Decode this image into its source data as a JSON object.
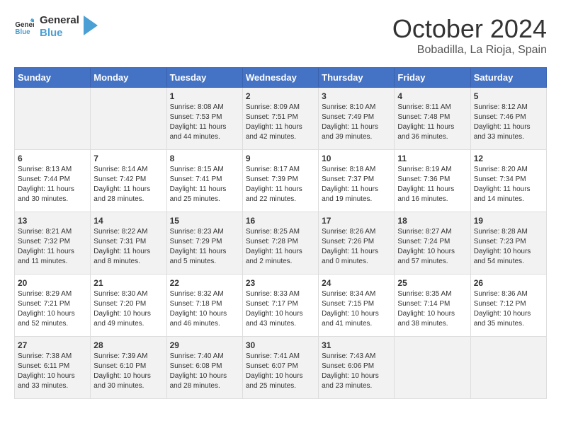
{
  "logo": {
    "line1": "General",
    "line2": "Blue"
  },
  "title": "October 2024",
  "subtitle": "Bobadilla, La Rioja, Spain",
  "days_of_week": [
    "Sunday",
    "Monday",
    "Tuesday",
    "Wednesday",
    "Thursday",
    "Friday",
    "Saturday"
  ],
  "weeks": [
    [
      {
        "day": "",
        "text": ""
      },
      {
        "day": "",
        "text": ""
      },
      {
        "day": "1",
        "text": "Sunrise: 8:08 AM\nSunset: 7:53 PM\nDaylight: 11 hours and 44 minutes."
      },
      {
        "day": "2",
        "text": "Sunrise: 8:09 AM\nSunset: 7:51 PM\nDaylight: 11 hours and 42 minutes."
      },
      {
        "day": "3",
        "text": "Sunrise: 8:10 AM\nSunset: 7:49 PM\nDaylight: 11 hours and 39 minutes."
      },
      {
        "day": "4",
        "text": "Sunrise: 8:11 AM\nSunset: 7:48 PM\nDaylight: 11 hours and 36 minutes."
      },
      {
        "day": "5",
        "text": "Sunrise: 8:12 AM\nSunset: 7:46 PM\nDaylight: 11 hours and 33 minutes."
      }
    ],
    [
      {
        "day": "6",
        "text": "Sunrise: 8:13 AM\nSunset: 7:44 PM\nDaylight: 11 hours and 30 minutes."
      },
      {
        "day": "7",
        "text": "Sunrise: 8:14 AM\nSunset: 7:42 PM\nDaylight: 11 hours and 28 minutes."
      },
      {
        "day": "8",
        "text": "Sunrise: 8:15 AM\nSunset: 7:41 PM\nDaylight: 11 hours and 25 minutes."
      },
      {
        "day": "9",
        "text": "Sunrise: 8:17 AM\nSunset: 7:39 PM\nDaylight: 11 hours and 22 minutes."
      },
      {
        "day": "10",
        "text": "Sunrise: 8:18 AM\nSunset: 7:37 PM\nDaylight: 11 hours and 19 minutes."
      },
      {
        "day": "11",
        "text": "Sunrise: 8:19 AM\nSunset: 7:36 PM\nDaylight: 11 hours and 16 minutes."
      },
      {
        "day": "12",
        "text": "Sunrise: 8:20 AM\nSunset: 7:34 PM\nDaylight: 11 hours and 14 minutes."
      }
    ],
    [
      {
        "day": "13",
        "text": "Sunrise: 8:21 AM\nSunset: 7:32 PM\nDaylight: 11 hours and 11 minutes."
      },
      {
        "day": "14",
        "text": "Sunrise: 8:22 AM\nSunset: 7:31 PM\nDaylight: 11 hours and 8 minutes."
      },
      {
        "day": "15",
        "text": "Sunrise: 8:23 AM\nSunset: 7:29 PM\nDaylight: 11 hours and 5 minutes."
      },
      {
        "day": "16",
        "text": "Sunrise: 8:25 AM\nSunset: 7:28 PM\nDaylight: 11 hours and 2 minutes."
      },
      {
        "day": "17",
        "text": "Sunrise: 8:26 AM\nSunset: 7:26 PM\nDaylight: 11 hours and 0 minutes."
      },
      {
        "day": "18",
        "text": "Sunrise: 8:27 AM\nSunset: 7:24 PM\nDaylight: 10 hours and 57 minutes."
      },
      {
        "day": "19",
        "text": "Sunrise: 8:28 AM\nSunset: 7:23 PM\nDaylight: 10 hours and 54 minutes."
      }
    ],
    [
      {
        "day": "20",
        "text": "Sunrise: 8:29 AM\nSunset: 7:21 PM\nDaylight: 10 hours and 52 minutes."
      },
      {
        "day": "21",
        "text": "Sunrise: 8:30 AM\nSunset: 7:20 PM\nDaylight: 10 hours and 49 minutes."
      },
      {
        "day": "22",
        "text": "Sunrise: 8:32 AM\nSunset: 7:18 PM\nDaylight: 10 hours and 46 minutes."
      },
      {
        "day": "23",
        "text": "Sunrise: 8:33 AM\nSunset: 7:17 PM\nDaylight: 10 hours and 43 minutes."
      },
      {
        "day": "24",
        "text": "Sunrise: 8:34 AM\nSunset: 7:15 PM\nDaylight: 10 hours and 41 minutes."
      },
      {
        "day": "25",
        "text": "Sunrise: 8:35 AM\nSunset: 7:14 PM\nDaylight: 10 hours and 38 minutes."
      },
      {
        "day": "26",
        "text": "Sunrise: 8:36 AM\nSunset: 7:12 PM\nDaylight: 10 hours and 35 minutes."
      }
    ],
    [
      {
        "day": "27",
        "text": "Sunrise: 7:38 AM\nSunset: 6:11 PM\nDaylight: 10 hours and 33 minutes."
      },
      {
        "day": "28",
        "text": "Sunrise: 7:39 AM\nSunset: 6:10 PM\nDaylight: 10 hours and 30 minutes."
      },
      {
        "day": "29",
        "text": "Sunrise: 7:40 AM\nSunset: 6:08 PM\nDaylight: 10 hours and 28 minutes."
      },
      {
        "day": "30",
        "text": "Sunrise: 7:41 AM\nSunset: 6:07 PM\nDaylight: 10 hours and 25 minutes."
      },
      {
        "day": "31",
        "text": "Sunrise: 7:43 AM\nSunset: 6:06 PM\nDaylight: 10 hours and 23 minutes."
      },
      {
        "day": "",
        "text": ""
      },
      {
        "day": "",
        "text": ""
      }
    ]
  ]
}
